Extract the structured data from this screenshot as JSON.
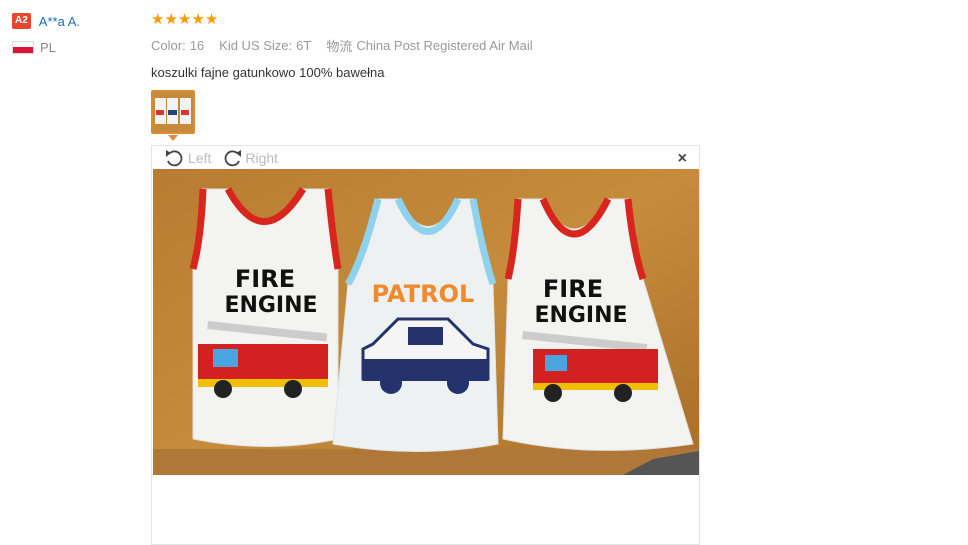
{
  "user": {
    "badge": "A2",
    "name": "A**a A.",
    "country": "PL"
  },
  "review": {
    "rating": 5,
    "color_label": "Color:",
    "color_value": "16",
    "size_label": "Kid US Size:",
    "size_value": "6T",
    "shipping_cn": "物流",
    "shipping": "China Post Registered Air Mail",
    "text": "koszulki fajne gatunkowo 100% bawełna"
  },
  "viewer": {
    "rotate_left": "Left",
    "rotate_right": "Right",
    "close": "×"
  },
  "photo": {
    "shirts": [
      {
        "line1": "FIRE",
        "line2": "ENGINE"
      },
      {
        "line1": "PATROL",
        "line2": ""
      },
      {
        "line1": "FIRE",
        "line2": "ENGINE"
      }
    ]
  }
}
